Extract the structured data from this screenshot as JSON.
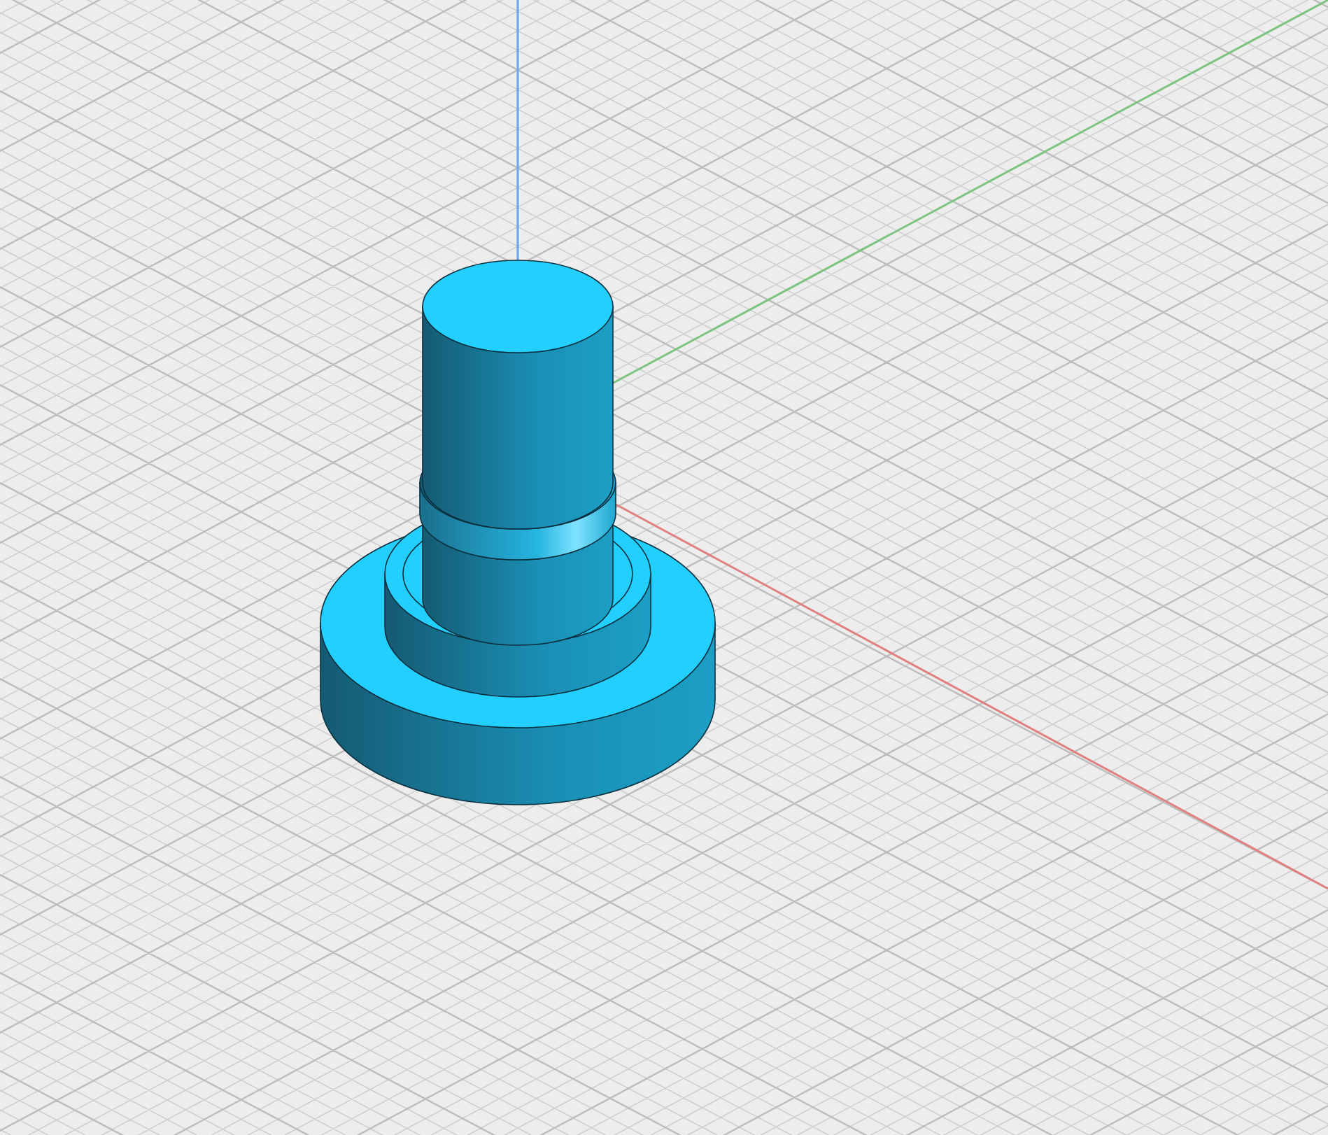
{
  "viewport": {
    "axes": [
      {
        "kind": "vertical",
        "color": "#6aa8f0"
      },
      {
        "kind": "depth",
        "color": "#7cc47f"
      },
      {
        "kind": "horizontal",
        "color": "#e08080"
      }
    ]
  }
}
